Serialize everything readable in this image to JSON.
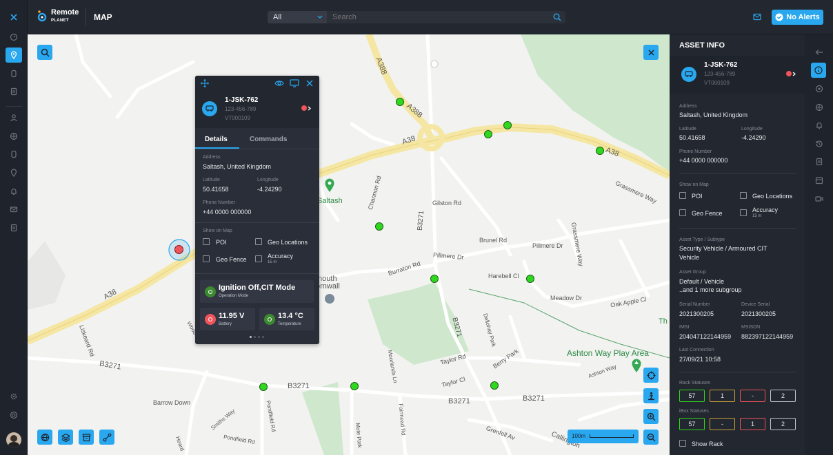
{
  "app": {
    "name": "Remote",
    "sub": "PLANET",
    "page_title": "MAP"
  },
  "topbar": {
    "filter_value": "All",
    "search_placeholder": "Search",
    "alerts_label": "No Alerts"
  },
  "map": {
    "labels": {
      "a388_1": "A388",
      "a388_2": "A388",
      "a38_1": "A38",
      "a38_2": "A38",
      "a38_3": "A38",
      "saltash": "Saltash",
      "gilston": "Gilston Rd",
      "b3271_v": "B3271",
      "b3271_1": "B3271",
      "b3271_2": "B3271",
      "b3271_3": "B3271",
      "b3271_4": "B3271",
      "brunel": "Brunel Rd",
      "pillmere": "Pillmere Dr",
      "pillmere2": "Pillmere Dr",
      "grassmere": "Grassmere Way",
      "grassmere2": "Grassmere Way",
      "burraton": "Burraton Rd",
      "harebell": "Harebell Cl",
      "meadow": "Meadow Dr",
      "oakapple": "Oak Apple Cl",
      "liskeard": "Liskeard Rd",
      "wood": "Wood",
      "barrow": "Barrow Down",
      "smiths": "Smiths Way",
      "pondfield": "Pondfield Rd",
      "pondfield2": "Pondfield Rd",
      "heard": "Heard",
      "moorlands": "Moorlands Ln",
      "fairmead": "Fairmead Rd",
      "mote": "Mote Park",
      "dellohay": "Dellohay Park",
      "taylor": "Taylor Rd",
      "taylorcl": "Taylor Cl",
      "berry": "Berry Park",
      "ashtonway": "Ashton Way",
      "ashton_park": "Ashton Way Play Area",
      "grenfell": "Grenfell Av",
      "callington": "Callington",
      "channon": "Channon Rd",
      "plymouth1": "mouth",
      "plymouth2": "ornwall",
      "th": "Th",
      "scale": "100m"
    }
  },
  "popup": {
    "asset_name": "1-JSK-762",
    "asset_phone": "123-456-789",
    "asset_id": "VT000109",
    "tabs": [
      "Details",
      "Commands"
    ],
    "address_label": "Address",
    "address": "Saltash, United Kingdom",
    "lat_label": "Latitude",
    "lat": "50.41658",
    "lon_label": "Longitude",
    "lon": "-4.24290",
    "phone_label": "Phone Number",
    "phone": "+44 0000 000000",
    "show_label": "Show on Map",
    "opt_poi": "POI",
    "opt_geoloc": "Geo Locations",
    "opt_geofence": "Geo Fence",
    "opt_accuracy": "Accuracy",
    "opt_accuracy_sub": "15 m",
    "ignition": "Ignition Off,CIT Mode",
    "ignition_sub": "Operation Mode",
    "battery": "11.95 V",
    "battery_sub": "Battery",
    "temp": "13.4 °C",
    "temp_sub": "Temperature"
  },
  "info": {
    "title": "ASSET INFO",
    "asset_name": "1-JSK-762",
    "asset_phone": "123-456-789",
    "asset_id": "VT000109",
    "address_label": "Address",
    "address": "Saltash, United Kingdom",
    "lat_label": "Latitude",
    "lat": "50.41658",
    "lon_label": "Longitude",
    "lon": "-4.24290",
    "phone_label": "Phone Number",
    "phone": "+44 0000 000000",
    "show_label": "Show on Map",
    "opt_poi": "POI",
    "opt_geoloc": "Geo Locations",
    "opt_geofence": "Geo Fence",
    "opt_accuracy": "Accuracy",
    "opt_accuracy_sub": "15 m",
    "type_label": "Asset Type / Subtype",
    "type_line1": "Security Vehicle / Armoured CIT",
    "type_line2": "Vehicle",
    "group_label": "Asset Group",
    "group_line1": "Default / Vehicle",
    "group_line2": "..and 1 more subgroup",
    "serial_label": "Serial Number",
    "serial": "2021300205",
    "dserial_label": "Device Serial",
    "dserial": "2021300205",
    "imsi_label": "IMSI",
    "imsi": "204047122144959",
    "msisdn_label": "MSISDN",
    "msisdn": "882397122144959",
    "last_label": "Last Connection",
    "last": "27/09/21 10:58",
    "rack_label": "Rack Statuses",
    "rack": [
      "57",
      "1",
      "-",
      "2"
    ],
    "ibox_label": "iBox Statuses",
    "ibox": [
      "57",
      "-",
      "1",
      "2"
    ],
    "show_rack": "Show Rack"
  },
  "colors": {
    "accent": "#29a7ef",
    "green": "#2fd81f",
    "red": "#f0545a",
    "yellow": "#c9a13a"
  }
}
